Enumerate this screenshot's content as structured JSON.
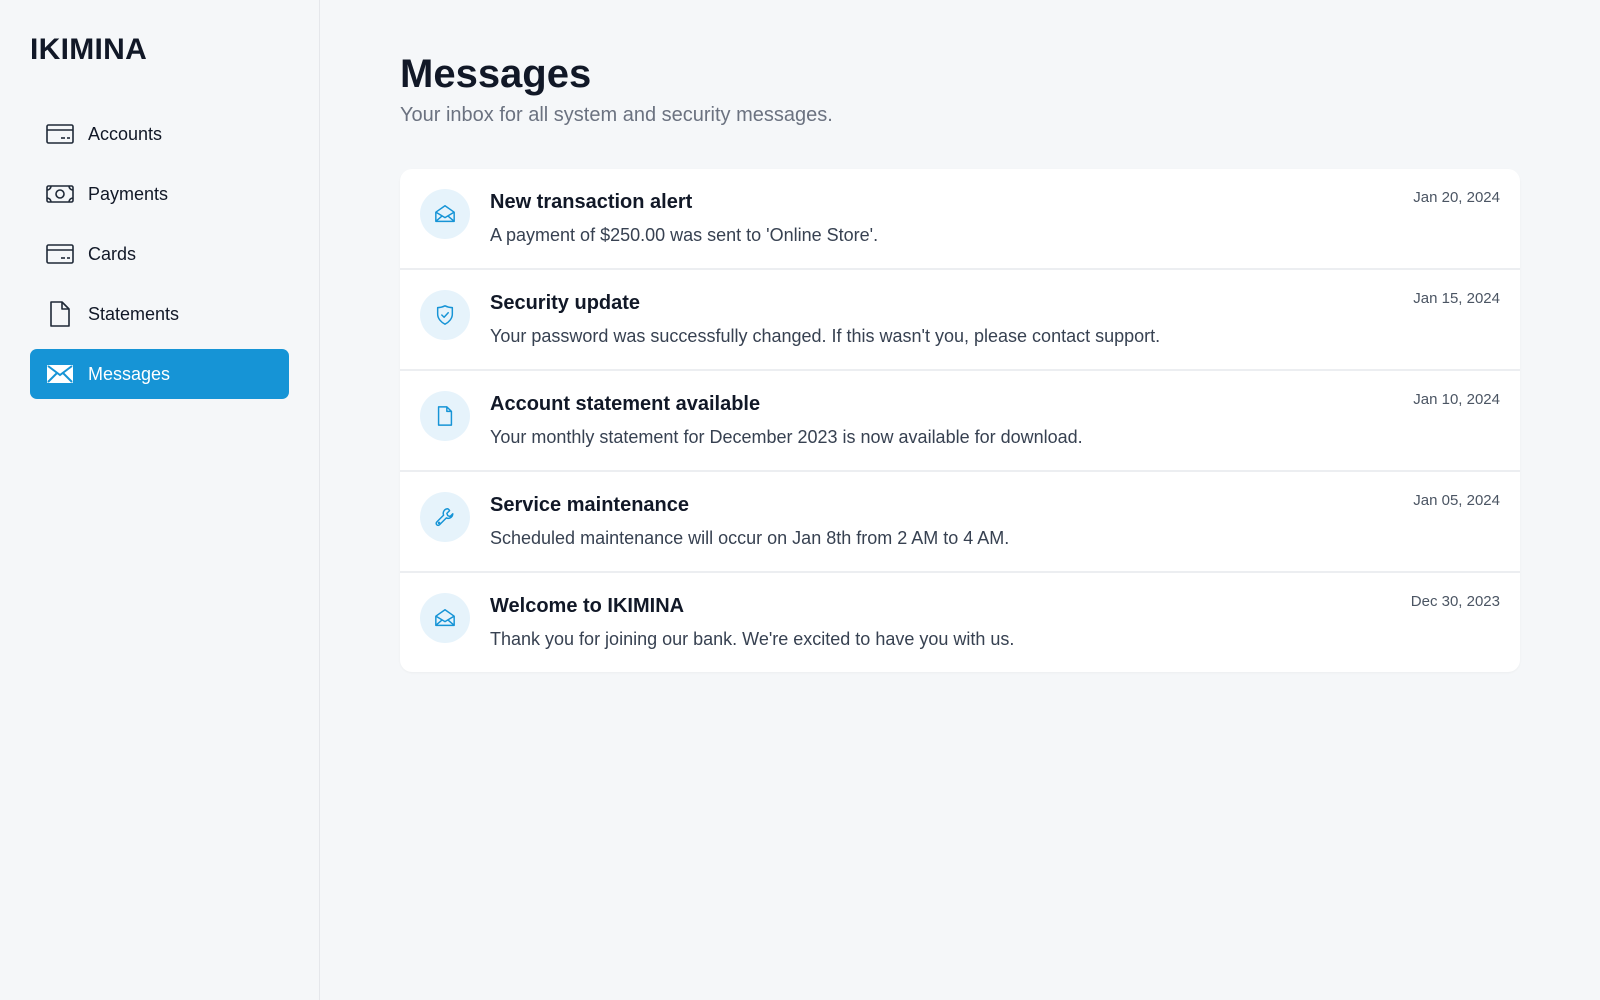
{
  "brand": "IKIMINA",
  "sidebar": {
    "items": [
      {
        "label": "Accounts",
        "icon": "credit-card-icon"
      },
      {
        "label": "Payments",
        "icon": "cash-icon"
      },
      {
        "label": "Cards",
        "icon": "credit-card-icon"
      },
      {
        "label": "Statements",
        "icon": "document-icon"
      },
      {
        "label": "Messages",
        "icon": "envelope-icon",
        "active": true
      }
    ]
  },
  "page": {
    "title": "Messages",
    "subtitle": "Your inbox for all system and security messages."
  },
  "messages": [
    {
      "icon": "envelope-open-icon",
      "title": "New transaction alert",
      "body": "A payment of $250.00 was sent to 'Online Store'.",
      "date": "Jan 20, 2024"
    },
    {
      "icon": "shield-check-icon",
      "title": "Security update",
      "body": "Your password was successfully changed. If this wasn't you, please contact support.",
      "date": "Jan 15, 2024"
    },
    {
      "icon": "document-icon",
      "title": "Account statement available",
      "body": "Your monthly statement for December 2023 is now available for download.",
      "date": "Jan 10, 2024"
    },
    {
      "icon": "wrench-icon",
      "title": "Service maintenance",
      "body": "Scheduled maintenance will occur on Jan 8th from 2 AM to 4 AM.",
      "date": "Jan 05, 2024"
    },
    {
      "icon": "envelope-open-icon",
      "title": "Welcome to IKIMINA",
      "body": "Thank you for joining our bank. We're excited to have you with us.",
      "date": "Dec 30, 2023"
    }
  ],
  "colors": {
    "accent": "#1694d6",
    "icon_bg": "#e6f3fb",
    "background": "#f5f7f9"
  }
}
